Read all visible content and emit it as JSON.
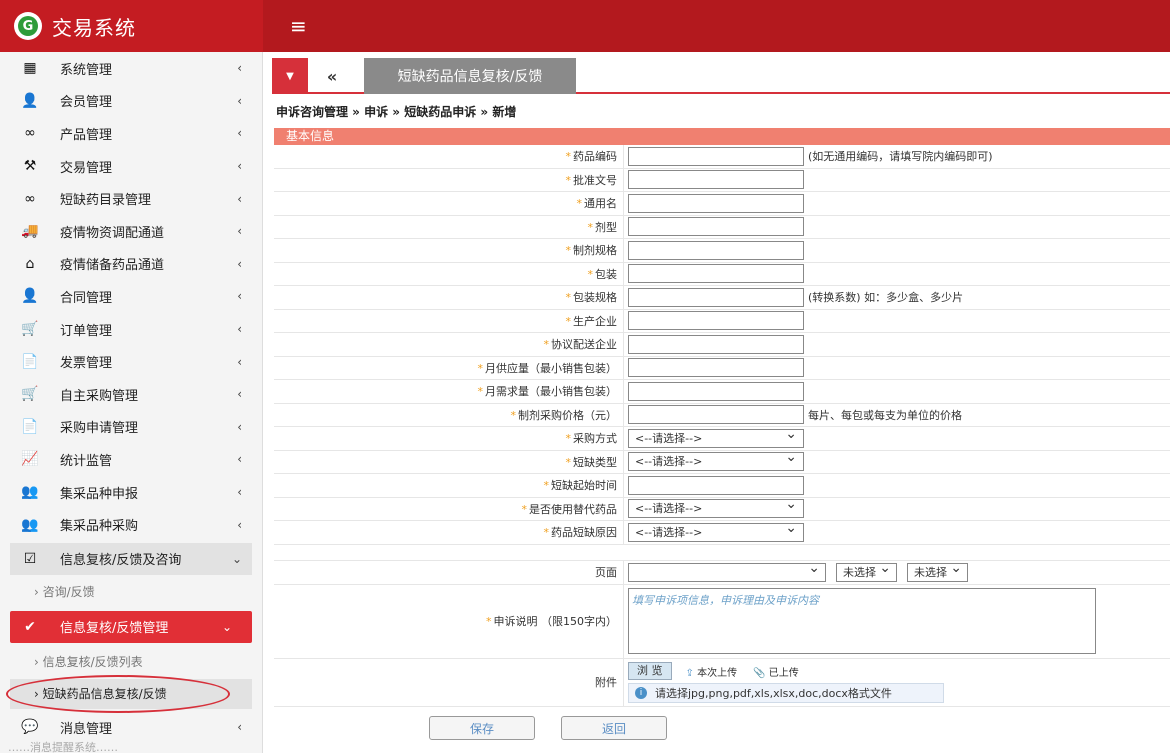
{
  "app": {
    "title": "交易系统",
    "logo_letter": "G"
  },
  "sidebar": {
    "items": [
      {
        "label": "系统管理",
        "icon": "grid-icon",
        "glyph": "▦"
      },
      {
        "label": "会员管理",
        "icon": "user-icon",
        "glyph": "👤"
      },
      {
        "label": "产品管理",
        "icon": "binoculars-icon",
        "glyph": "∞"
      },
      {
        "label": "交易管理",
        "icon": "gavel-icon",
        "glyph": "⚒"
      },
      {
        "label": "短缺药目录管理",
        "icon": "binoculars-icon",
        "glyph": "∞"
      },
      {
        "label": "疫情物资调配通道",
        "icon": "truck-icon",
        "glyph": "🚚"
      },
      {
        "label": "疫情储备药品通道",
        "icon": "warehouse-icon",
        "glyph": "⌂"
      },
      {
        "label": "合同管理",
        "icon": "user-sign-icon",
        "glyph": "👤"
      },
      {
        "label": "订单管理",
        "icon": "cart-icon",
        "glyph": "🛒"
      },
      {
        "label": "发票管理",
        "icon": "file-dollar-icon",
        "glyph": "📄"
      },
      {
        "label": "自主采购管理",
        "icon": "cart-icon",
        "glyph": "🛒"
      },
      {
        "label": "采购申请管理",
        "icon": "file-icon",
        "glyph": "📄"
      },
      {
        "label": "统计监管",
        "icon": "line-chart-icon",
        "glyph": "📈"
      },
      {
        "label": "集采品种申报",
        "icon": "users-icon",
        "glyph": "👥"
      },
      {
        "label": "集采品种采购",
        "icon": "users-icon",
        "glyph": "👥"
      }
    ],
    "group1": {
      "label": "信息复核/反馈及咨询",
      "glyph": "☑"
    },
    "group1_sub": "› 咨询/反馈",
    "group2": {
      "label": "信息复核/反馈管理",
      "glyph": "✔"
    },
    "group2_sub1": "› 信息复核/反馈列表",
    "group2_sub2": "› 短缺药品信息复核/反馈",
    "msg": {
      "label": "消息管理",
      "glyph": "💬"
    },
    "footer": "……消息提醒系统……"
  },
  "tabs": {
    "active": "短缺药品信息复核/反馈"
  },
  "breadcrumb": "申诉咨询管理 » 申诉 » 短缺药品申诉 » 新增",
  "section": "基本信息",
  "form": {
    "fields": [
      {
        "label": "药品编码",
        "type": "input",
        "hint": "(如无通用编码，请填写院内编码即可)"
      },
      {
        "label": "批准文号",
        "type": "input",
        "hint": ""
      },
      {
        "label": "通用名",
        "type": "input",
        "hint": ""
      },
      {
        "label": "剂型",
        "type": "input",
        "hint": ""
      },
      {
        "label": "制剂规格",
        "type": "input",
        "hint": ""
      },
      {
        "label": "包装",
        "type": "input",
        "hint": ""
      },
      {
        "label": "包装规格",
        "type": "input",
        "hint": "(转换系数) 如：多少盒、多少片"
      },
      {
        "label": "生产企业",
        "type": "input",
        "hint": ""
      },
      {
        "label": "协议配送企业",
        "type": "input",
        "hint": ""
      },
      {
        "label": "月供应量（最小销售包装）",
        "type": "input",
        "hint": ""
      },
      {
        "label": "月需求量（最小销售包装）",
        "type": "input",
        "hint": ""
      },
      {
        "label": "制剂采购价格（元）",
        "type": "input",
        "hint": "每片、每包或每支为单位的价格"
      },
      {
        "label": "采购方式",
        "type": "select",
        "hint": ""
      },
      {
        "label": "短缺类型",
        "type": "select",
        "hint": ""
      },
      {
        "label": "短缺起始时间",
        "type": "input",
        "hint": ""
      },
      {
        "label": "是否使用替代药品",
        "type": "select",
        "hint": ""
      },
      {
        "label": "药品短缺原因",
        "type": "select",
        "hint": ""
      }
    ],
    "select_placeholder": "<--请选择-->",
    "page_label": "页面",
    "page_select2": "未选择",
    "page_select3": "未选择",
    "appeal_label": "申诉说明 （限150字内）",
    "appeal_placeholder": "填写申诉项信息，申诉理由及申诉内容",
    "attach_label": "附件",
    "browse": "浏 览",
    "upload_this": "本次上传",
    "uploaded": "已上传",
    "attach_note": "请选择jpg,png,pdf,xls,xlsx,doc,docx格式文件"
  },
  "buttons": {
    "save": "保存",
    "back": "返回"
  },
  "colors": {
    "topbar": "#b3191e",
    "accent": "#d6303a",
    "section": "#f08070"
  }
}
